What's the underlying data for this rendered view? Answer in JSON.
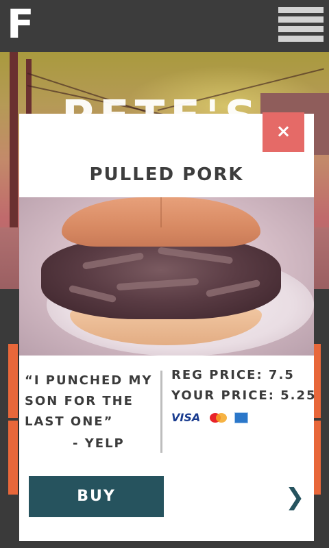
{
  "header": {
    "logo_text": "F",
    "menu_icon": "hamburger-menu-icon"
  },
  "hero": {
    "title": "PETE'S"
  },
  "modal": {
    "close_label": "×",
    "title": "PULLED PORK",
    "image_alt": "pulled pork sandwich",
    "quote": "“I PUNCHED MY SON FOR THE LAST ONE”",
    "quote_source": "- YELP",
    "reg_price_label": "REG PRICE: 7.5",
    "your_price_label": "YOUR PRICE: 5.25",
    "payment_icons": [
      "visa-icon",
      "mastercard-icon",
      "amex-icon"
    ],
    "visa_text": "VISA",
    "buy_label": "BUY",
    "next_label": "❯"
  },
  "colors": {
    "accent_orange": "#e8673a",
    "close_button": "#e56a67",
    "buy_button": "#26535e",
    "topbar": "#3c3c3c"
  }
}
